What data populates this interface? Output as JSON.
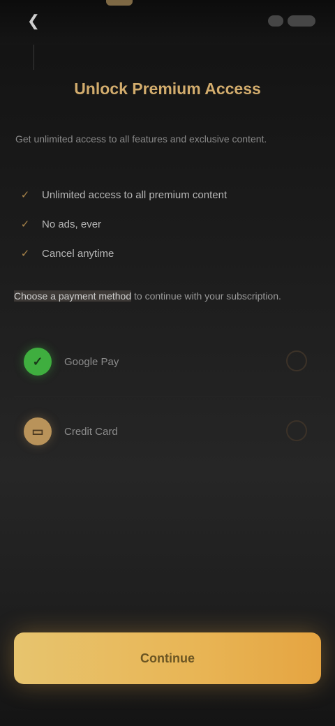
{
  "header": {
    "back_icon": "chevron-left-icon",
    "back_glyph": "❮"
  },
  "title": "Unlock Premium Access",
  "subtitle": "Get unlimited access to all features and exclusive content.",
  "bullets": [
    {
      "icon": "check-icon",
      "text": "Unlimited access to all premium content"
    },
    {
      "icon": "check-icon",
      "text": "No ads, ever"
    },
    {
      "icon": "check-icon",
      "text": "Cancel anytime"
    }
  ],
  "info": {
    "highlight": "Choose a payment method",
    "text": " to continue with your subscription."
  },
  "options": [
    {
      "label": "Google Pay",
      "avatar_color": "#3fae3f",
      "avatar_glyph": "✓"
    },
    {
      "label": "Credit Card",
      "avatar_color": "#b9935a",
      "avatar_glyph": "▭"
    }
  ],
  "cta": {
    "label": "Continue"
  },
  "colors": {
    "accent": "#d2ac6d",
    "button": "#e8b555"
  }
}
